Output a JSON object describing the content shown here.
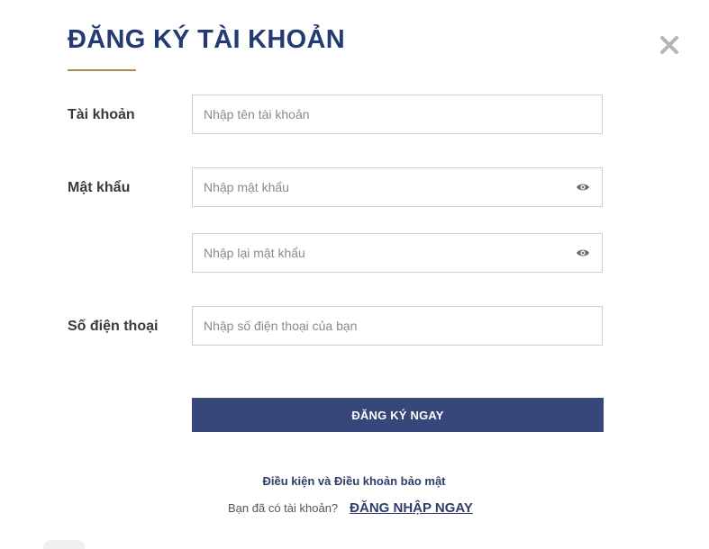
{
  "modal": {
    "title": "ĐĂNG KÝ TÀI KHOẢN",
    "close_icon": "close-icon"
  },
  "form": {
    "account": {
      "label": "Tài khoản",
      "placeholder": "Nhập tên tài khoản",
      "value": ""
    },
    "password": {
      "label": "Mật khẩu",
      "placeholder": "Nhập mật khẩu",
      "value": "",
      "toggle_icon": "eye-icon"
    },
    "password_confirm": {
      "placeholder": "Nhập lại mật khẩu",
      "value": "",
      "toggle_icon": "eye-icon"
    },
    "phone": {
      "label": "Số điện thoại",
      "placeholder": "Nhập số điện thoại của bạn",
      "value": ""
    },
    "submit_label": "ĐĂNG KÝ NGAY"
  },
  "footer": {
    "terms_link": "Điều kiện và Điều khoản bảo mật",
    "login_prompt": "Bạn đã có tài khoản?",
    "login_link": "ĐĂNG NHẬP NGAY"
  },
  "colors": {
    "title": "#243a73",
    "accent_underline": "#b08a5a",
    "button_bg": "#37477a",
    "link": "#2e3d6b"
  }
}
